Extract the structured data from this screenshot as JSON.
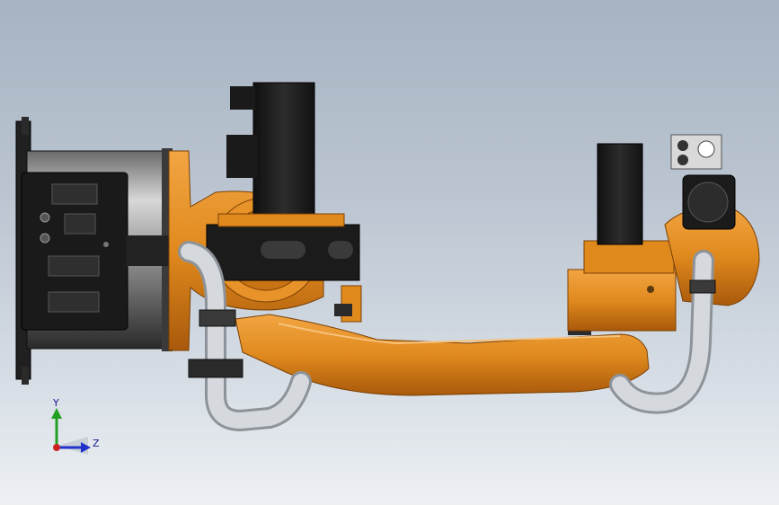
{
  "viewport": {
    "background_top": "#a7b3c2",
    "background_bottom": "#eef1f4"
  },
  "colors": {
    "orange": "#e08a1e",
    "orange_dark": "#b5650e",
    "orange_light": "#f2a543",
    "black": "#1b1b1b",
    "grey": "#3a3a3a",
    "silver": "#c9ccd1",
    "silver_dark": "#8e9399"
  },
  "triad": {
    "y_label": "Y",
    "z_label": "Z",
    "y_color": "#22a022",
    "z_color": "#2233cc",
    "origin_color": "#cc2222"
  }
}
